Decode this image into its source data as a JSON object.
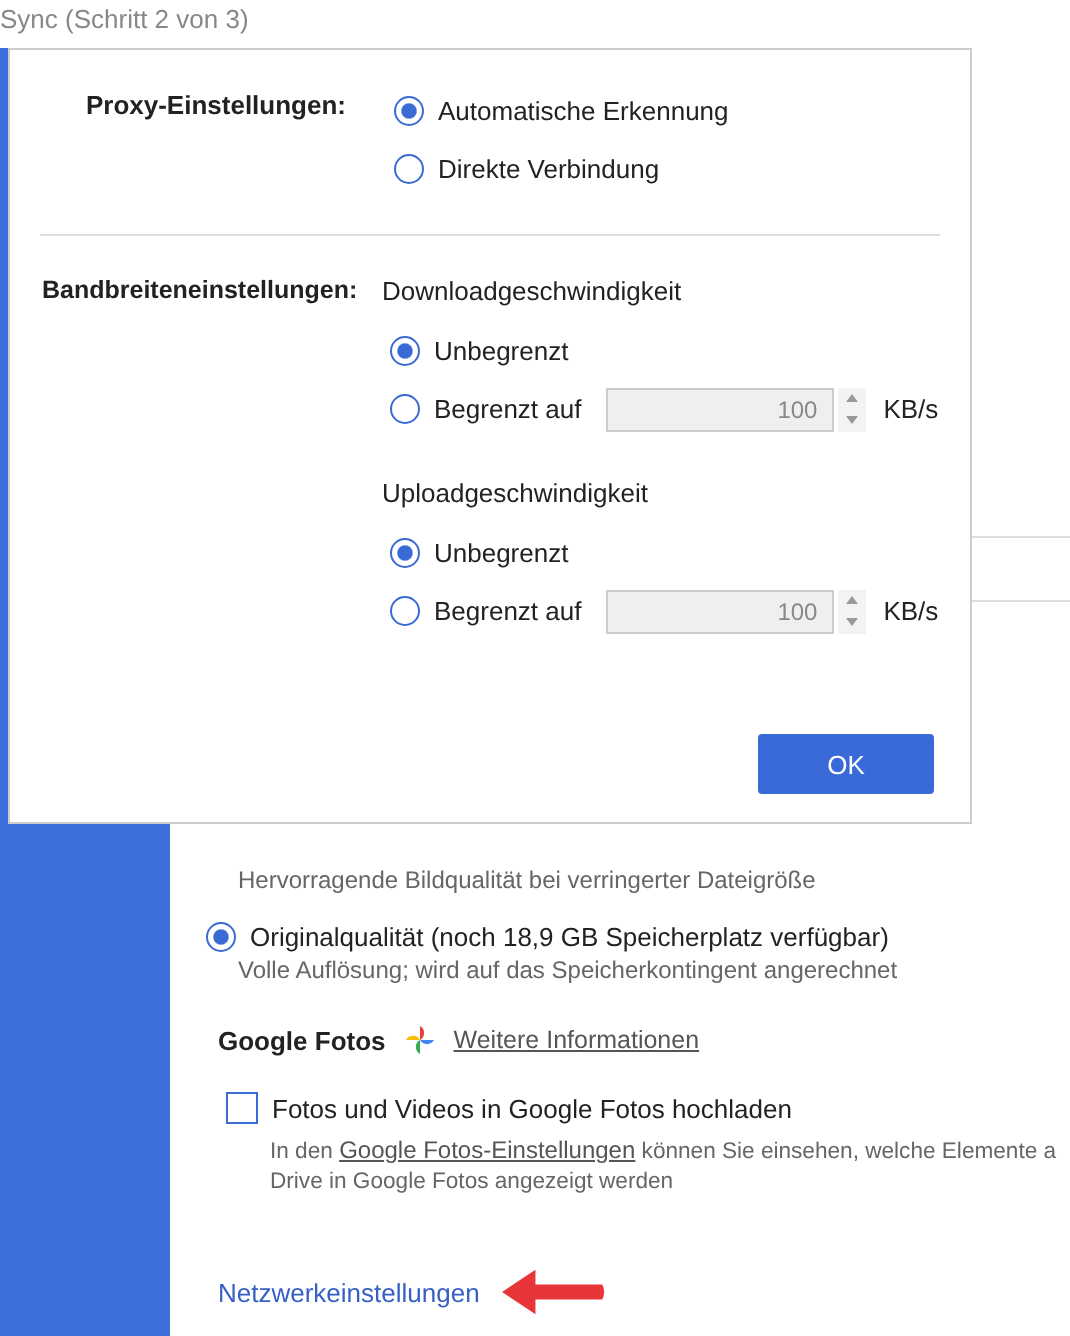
{
  "window": {
    "title": "Sync (Schritt 2 von 3)"
  },
  "dialog": {
    "proxy": {
      "label": "Proxy-Einstellungen:",
      "options": [
        {
          "label": "Automatische Erkennung",
          "selected": true
        },
        {
          "label": "Direkte Verbindung",
          "selected": false
        }
      ]
    },
    "bandwidth": {
      "label": "Bandbreiteneinstellungen:",
      "groups": [
        {
          "heading": "Downloadgeschwindigkeit",
          "options": [
            {
              "label": "Unbegrenzt",
              "selected": true
            },
            {
              "label": "Begrenzt auf",
              "selected": false,
              "limit": {
                "value": "100",
                "unit": "KB/s",
                "disabled": true
              }
            }
          ]
        },
        {
          "heading": "Uploadgeschwindigkeit",
          "options": [
            {
              "label": "Unbegrenzt",
              "selected": true
            },
            {
              "label": "Begrenzt auf",
              "selected": false,
              "limit": {
                "value": "100",
                "unit": "KB/s",
                "disabled": true
              }
            }
          ]
        }
      ]
    },
    "ok_button": "OK"
  },
  "background": {
    "quality_options": [
      {
        "description": "Hervorragende Bildqualität bei verringerter Dateigröße"
      },
      {
        "label": "Originalqualität (noch 18,9 GB Speicherplatz verfügbar)",
        "selected": true,
        "description": "Volle Auflösung; wird auf das Speicherkontingent angerechnet"
      }
    ],
    "google_photos": {
      "title": "Google Fotos",
      "link": "Weitere Informationen"
    },
    "upload": {
      "label": "Fotos und Videos in Google Fotos hochladen",
      "checked": false,
      "description": [
        {
          "text": "In den ",
          "link": "Google Fotos-Einstellungen",
          "rest": " können Sie einsehen, welche Elemente a"
        },
        {
          "text": "Drive in Google Fotos angezeigt werden"
        }
      ]
    },
    "network_link": "Netzwerkeinstellungen"
  }
}
